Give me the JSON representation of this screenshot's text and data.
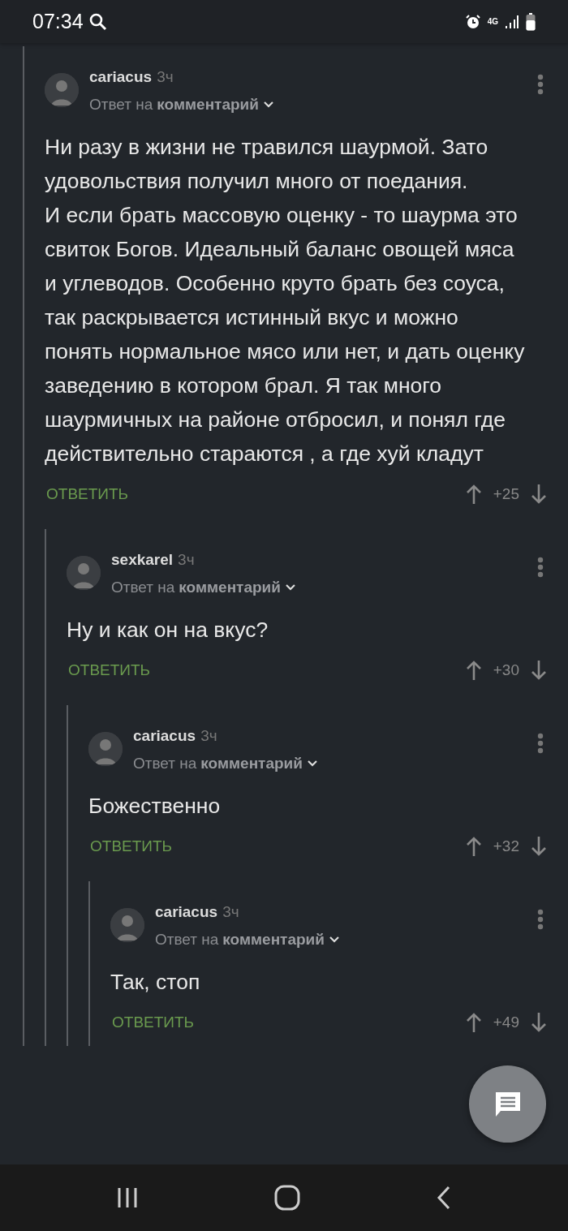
{
  "status_bar": {
    "time": "07:34",
    "network": "4G"
  },
  "comments": [
    {
      "author": "cariacus",
      "time": "3ч",
      "reply_prefix": "Ответ на",
      "reply_link": "комментарий",
      "body": [
        "Ни разу в жизни не травился шаурмой. Зато удовольствия получил много от поедания.",
        "И если брать массовую оценку - то шаурма это свиток Богов. Идеальный баланс овощей мяса и углеводов. Особенно круто брать без соуса, так раскрывается истинный вкус и можно понять нормальное мясо или нет, и дать оценку заведению в котором брал. Я так много шаурмичных на районе отбросил, и понял где действительно стараются , а где хуй кладут"
      ],
      "reply_button": "ОТВЕТИТЬ",
      "rating": "+25",
      "replies": [
        {
          "author": "sexkarel",
          "time": "3ч",
          "reply_prefix": "Ответ на",
          "reply_link": "комментарий",
          "body": [
            "Ну и как он на вкус?"
          ],
          "reply_button": "ОТВЕТИТЬ",
          "rating": "+30",
          "replies": [
            {
              "author": "cariacus",
              "time": "3ч",
              "reply_prefix": "Ответ на",
              "reply_link": "комментарий",
              "body": [
                "Божественно"
              ],
              "reply_button": "ОТВЕТИТЬ",
              "rating": "+32",
              "replies": [
                {
                  "author": "cariacus",
                  "time": "3ч",
                  "reply_prefix": "Ответ на",
                  "reply_link": "комментарий",
                  "body": [
                    "Так, стоп"
                  ],
                  "reply_button": "ОТВЕТИТЬ",
                  "rating": "+49"
                }
              ]
            }
          ]
        }
      ]
    }
  ]
}
